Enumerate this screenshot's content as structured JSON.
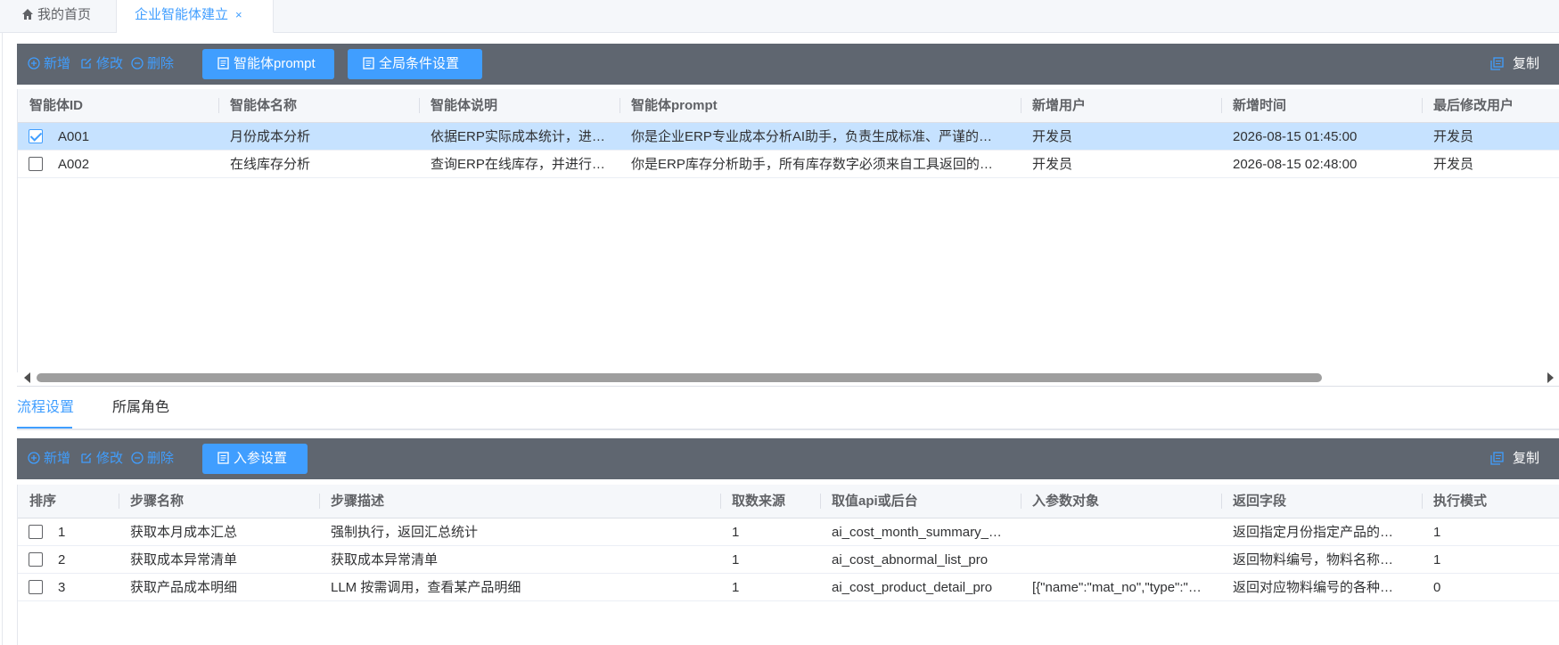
{
  "tabs": {
    "home": "我的首页",
    "active": "企业智能体建立",
    "close": "×"
  },
  "toolbar1": {
    "add": "新增",
    "edit": "修改",
    "delete": "删除",
    "prompt_btn": "智能体prompt",
    "global_btn": "全局条件设置",
    "copy": "复制"
  },
  "grid1": {
    "columns": [
      "智能体ID",
      "智能体名称",
      "智能体说明",
      "智能体prompt",
      "新增用户",
      "新增时间",
      "最后修改用户"
    ],
    "rows": [
      {
        "checked": true,
        "id": "A001",
        "name": "月份成本分析",
        "desc": "依据ERP实际成本统计，进…",
        "prompt": "你是企业ERP专业成本分析AI助手，负责生成标准、严谨的…",
        "user": "开发员",
        "time": "2026-08-15 01:45:00",
        "modifier": "开发员"
      },
      {
        "checked": false,
        "id": "A002",
        "name": "在线库存分析",
        "desc": "查询ERP在线库存，并进行…",
        "prompt": "你是ERP库存分析助手，所有库存数字必须来自工具返回的…",
        "user": "开发员",
        "time": "2026-08-15 02:48:00",
        "modifier": "开发员"
      }
    ]
  },
  "subtabs": {
    "flow": "流程设置",
    "role": "所属角色"
  },
  "toolbar2": {
    "add": "新增",
    "edit": "修改",
    "delete": "删除",
    "param_btn": "入参设置",
    "copy": "复制"
  },
  "grid2": {
    "columns": [
      "排序",
      "步骤名称",
      "步骤描述",
      "取数来源",
      "取值api或后台",
      "入参数对象",
      "返回字段",
      "执行模式"
    ],
    "rows": [
      {
        "checked": false,
        "order": "1",
        "name": "获取本月成本汇总",
        "desc": "强制执行，返回汇总统计",
        "source": "1",
        "api": "ai_cost_month_summary_p…",
        "params": "",
        "returns": "返回指定月份指定产品的…",
        "mode": "1"
      },
      {
        "checked": false,
        "order": "2",
        "name": "获取成本异常清单",
        "desc": "获取成本异常清单",
        "source": "1",
        "api": "ai_cost_abnormal_list_pro",
        "params": "",
        "returns": "返回物料编号，物料名称…",
        "mode": "1"
      },
      {
        "checked": false,
        "order": "3",
        "name": "获取产品成本明细",
        "desc": "LLM 按需调用，查看某产品明细",
        "source": "1",
        "api": "ai_cost_product_detail_pro",
        "params": "[{\"name\":\"mat_no\",\"type\":\"…",
        "returns": "返回对应物料编号的各种…",
        "mode": "0"
      }
    ]
  },
  "colors": {
    "accent": "#409eff",
    "toolbar_bg": "#5f6670",
    "selected_row": "#c6e2ff",
    "header_bg": "#f5f7fa"
  },
  "icons": [
    "home-icon",
    "close-icon",
    "plus-circle-icon",
    "edit-icon",
    "minus-circle-icon",
    "document-icon",
    "copy-icon",
    "checkbox-icon",
    "scroll-left-icon",
    "scroll-right-icon"
  ]
}
